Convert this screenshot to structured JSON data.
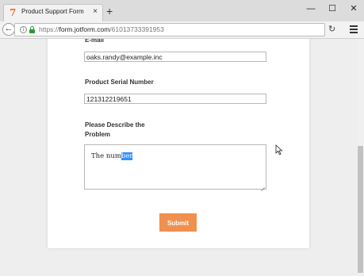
{
  "browser": {
    "tab_title": "Product Support Form",
    "tab_favicon": "7",
    "tab_close": "×",
    "new_tab": "+",
    "controls": {
      "minimize": "—",
      "maximize": "☐",
      "close": "✕"
    },
    "url_prefix": "https://",
    "url_domain": "form.jotform.com",
    "url_path": "/61013733391953",
    "reload": "↻"
  },
  "form": {
    "email_label": "E-mail",
    "email_value": "oaks.randy@example.inc",
    "serial_label": "Product Serial Number",
    "serial_value": "121312219651",
    "problem_label_line1": "Please Describe the",
    "problem_label_line2": "Problem",
    "problem_text_before": "The num",
    "problem_text_selected": "ber",
    "submit_label": "Submit"
  },
  "colors": {
    "accent": "#f0904f",
    "selection": "#3390ff",
    "lock": "#2a9a3a"
  }
}
